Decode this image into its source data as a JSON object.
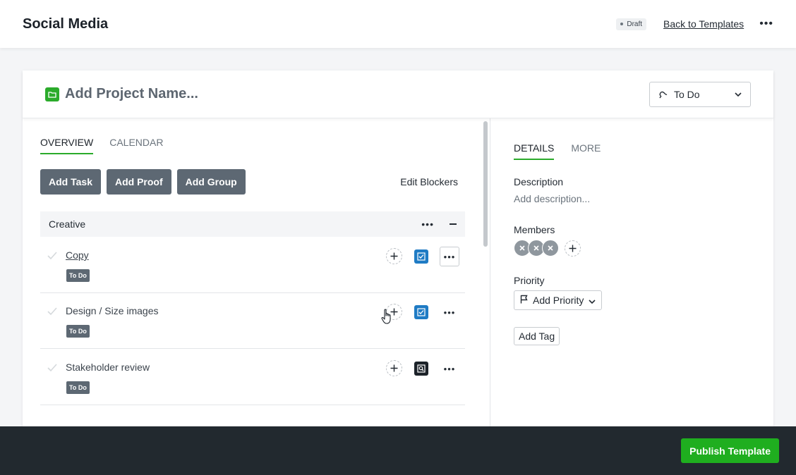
{
  "header": {
    "title": "Social Media",
    "draft_label": "Draft",
    "back_link": "Back to Templates",
    "more_label": "•••"
  },
  "project": {
    "name_placeholder": "Add Project Name...",
    "status": "To Do",
    "folder_color": "#2bab2b"
  },
  "left": {
    "tabs": [
      {
        "label": "OVERVIEW",
        "active": true
      },
      {
        "label": "CALENDAR",
        "active": false
      }
    ],
    "actions": {
      "add_task": "Add Task",
      "add_proof": "Add Proof",
      "add_group": "Add Group",
      "edit_blockers": "Edit Blockers"
    },
    "group": {
      "name": "Creative",
      "more": "•••"
    },
    "tasks": [
      {
        "name": "Copy",
        "status": "To Do",
        "type": "task",
        "more": "•••"
      },
      {
        "name": "Design / Size images",
        "status": "To Do",
        "type": "task",
        "more": "•••"
      },
      {
        "name": "Stakeholder review",
        "status": "To Do",
        "type": "proof",
        "more": "•••"
      }
    ]
  },
  "right": {
    "tabs": [
      {
        "label": "DETAILS",
        "active": true
      },
      {
        "label": "MORE",
        "active": false
      }
    ],
    "description_label": "Description",
    "description_placeholder": "Add description...",
    "members_label": "Members",
    "priority_label": "Priority",
    "priority_button": "Add Priority",
    "add_tag": "Add Tag"
  },
  "footer": {
    "publish": "Publish Template"
  },
  "colors": {
    "accent_green": "#2bab2b",
    "dark_button": "#5d6873",
    "task_icon_blue": "#1f7bc4",
    "footer_bg": "#22292f"
  }
}
